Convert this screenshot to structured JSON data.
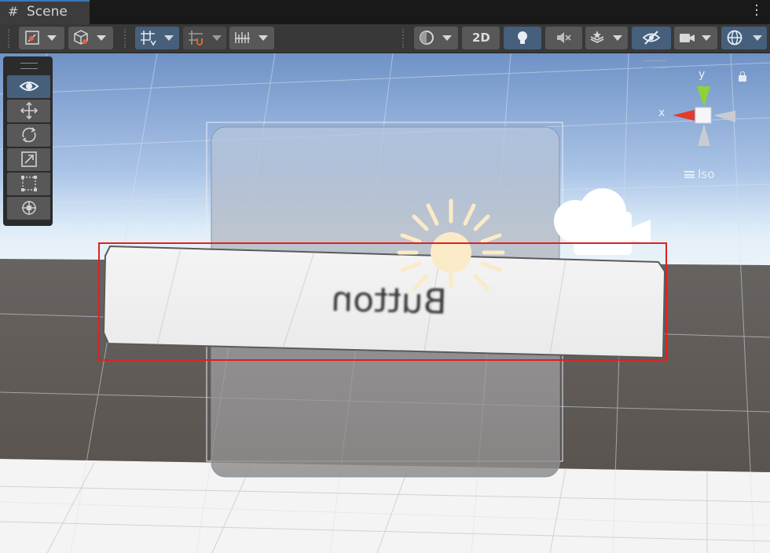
{
  "tab": {
    "icon": "hash-icon",
    "label": "Scene"
  },
  "toolbar": {
    "mode_2d_label": "2D",
    "accent_active": "#46607c"
  },
  "tools": [
    "view-tool",
    "move-tool",
    "rotate-tool",
    "scale-tool",
    "rect-tool",
    "transform-tool"
  ],
  "gizmo": {
    "y_label": "y",
    "x_label": "x",
    "projection_label": "Iso"
  },
  "scene": {
    "button_text": "Button"
  },
  "colors": {
    "selection": "#e02020",
    "sky": "#8fb3de",
    "ground": "#5d5752"
  }
}
